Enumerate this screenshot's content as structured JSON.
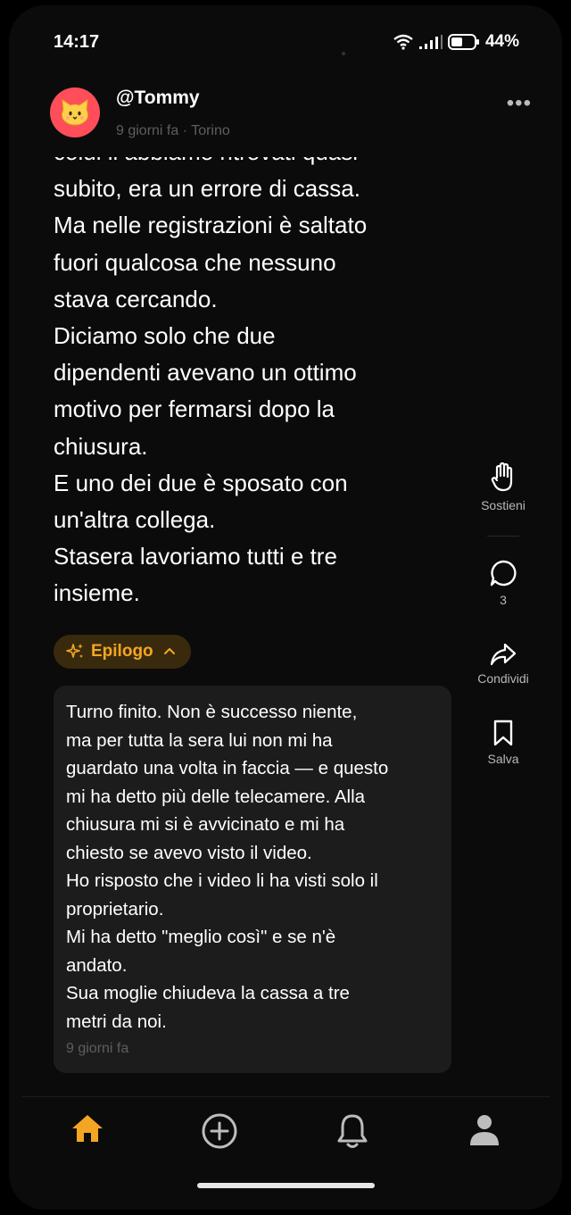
{
  "status_bar": {
    "time": "14:17",
    "battery": "44%"
  },
  "post": {
    "username": "@Tommy",
    "meta": "9 giorni fa · Torino",
    "body": "colui il abbiamo ritrovati quasi\nsubito, era un errore di cassa.\nMa nelle registrazioni è saltato\nfuori qualcosa che nessuno\nstava cercando.\nDiciamo solo che due\ndipendenti avevano un ottimo\nmotivo per fermarsi dopo la\nchiusura.\nE uno dei due è sposato con\nun'altra collega.\nStasera lavoriamo tutti e tre\ninsieme."
  },
  "actions": {
    "support_label": "Sostieni",
    "comments_count": "3",
    "share_label": "Condividi",
    "save_label": "Salva"
  },
  "epilogue": {
    "chip_label": "Epilogo",
    "text": "Turno finito. Non è successo niente,\nma per tutta la sera lui non mi ha\nguardato una volta in faccia — e questo\nmi ha detto più delle telecamere. Alla\nchiusura mi si è avvicinato e mi ha\nchiesto se avevo visto il video.\nHo risposto che i video li ha visti solo il\nproprietario.\nMi ha detto \"meglio così\" e se n'è\nandato.\nSua moglie chiudeva la cassa a tre\nmetri da noi.",
    "timestamp": "9 giorni fa"
  },
  "bottom_nav": {
    "items": [
      {
        "icon": "home-icon",
        "active": true
      },
      {
        "icon": "add-circle-icon",
        "active": false
      },
      {
        "icon": "bell-icon",
        "active": false
      },
      {
        "icon": "profile-icon",
        "active": false
      }
    ],
    "active_color": "#f3a623"
  },
  "colors": {
    "accent": "#f3a623",
    "avatar_bg": "#ff4d5a",
    "card_bg": "#1c1c1c"
  }
}
